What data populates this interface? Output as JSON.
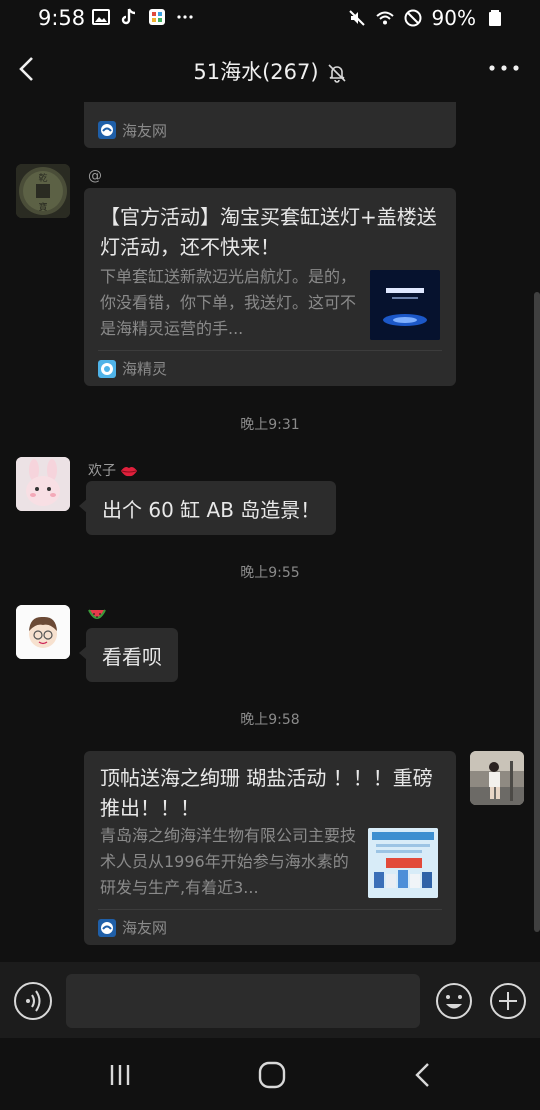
{
  "status_bar": {
    "time": "9:58",
    "battery": "90%"
  },
  "header": {
    "title": "51海水(267)"
  },
  "messages": {
    "card1": {
      "source": "海友网"
    },
    "card2": {
      "sender": "@",
      "title": "【官方活动】淘宝买套缸送灯+盖楼送灯活动，还不快来！",
      "desc": "下单套缸送新款迈光启航灯。是的，你没看错，你下单，我送灯。这可不是海精灵运营的手...",
      "source": "海精灵"
    },
    "time1": "晚上9:31",
    "msg3": {
      "sender": "欢子",
      "text": "出个 60 缸 AB 岛造景！"
    },
    "time2": "晚上9:55",
    "msg4": {
      "sender": "",
      "text": "看看呗"
    },
    "time3": "晚上9:58",
    "card5": {
      "title": "顶帖送海之绚珊 瑚盐活动 ！！！重磅推出！！！",
      "desc": "青岛海之绚海洋生物有限公司主要技术人员从1996年开始参与海水素的研发与生产,有着近3...",
      "source": "海友网"
    }
  },
  "input": {
    "placeholder": ""
  },
  "colors": {
    "background": "#111111",
    "bubble": "#2c2c2c",
    "text": "#e8e8e8",
    "meta": "#8a8a8a"
  },
  "icons": [
    "back-arrow-icon",
    "mute-bell-icon",
    "more-dots-icon",
    "voice-icon",
    "emoji-icon",
    "plus-icon",
    "recents-icon",
    "home-icon",
    "nav-back-icon"
  ]
}
